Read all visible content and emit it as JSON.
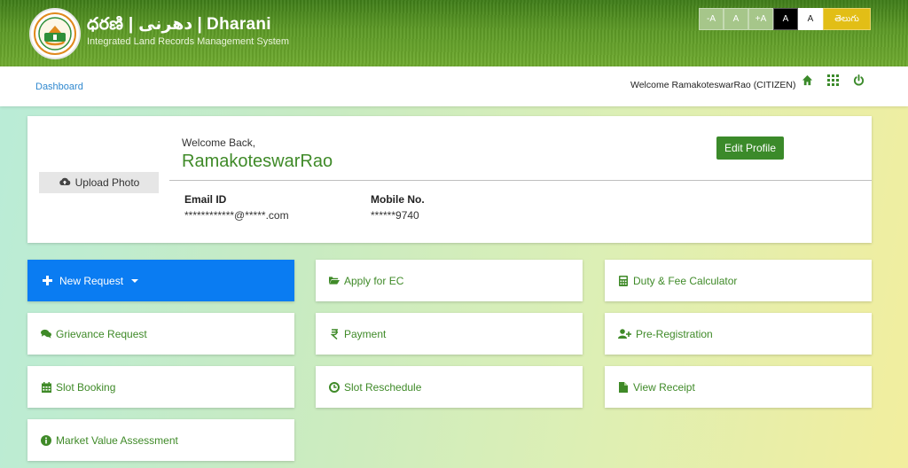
{
  "header": {
    "title": "ధరణి | دھرنی | Dharani",
    "subtitle": "Integrated Land Records Management System",
    "font_controls": [
      "-A",
      "A",
      "+A",
      "A",
      "A"
    ],
    "language_button": "తెలుగు"
  },
  "nav": {
    "breadcrumb": "Dashboard",
    "welcome_text": "Welcome  RamakoteswarRao (CITIZEN)",
    "icons": [
      "home-icon",
      "apps-grid-icon",
      "power-icon"
    ]
  },
  "profile": {
    "upload_label": "Upload Photo",
    "welcome_back": "Welcome Back,",
    "name": "RamakoteswarRao",
    "edit_button": "Edit Profile",
    "email_label": "Email ID",
    "email_value": "************@*****.com",
    "mobile_label": "Mobile No.",
    "mobile_value": "******9740"
  },
  "tiles": [
    {
      "label": "New Request",
      "icon": "plus-icon"
    },
    {
      "label": "Apply for EC",
      "icon": "folder-open-icon"
    },
    {
      "label": "Duty & Fee Calculator",
      "icon": "calculator-icon"
    },
    {
      "label": "Grievance Request",
      "icon": "comments-icon"
    },
    {
      "label": "Payment",
      "icon": "rupee-icon"
    },
    {
      "label": "Pre-Registration",
      "icon": "user-plus-icon"
    },
    {
      "label": "Slot Booking",
      "icon": "calendar-icon"
    },
    {
      "label": "Slot Reschedule",
      "icon": "clock-icon"
    },
    {
      "label": "View Receipt",
      "icon": "file-icon"
    },
    {
      "label": "Market Value Assessment",
      "icon": "info-circle-icon"
    }
  ],
  "colors": {
    "primary_blue": "#0a7cf2",
    "accent_green": "#3f8a28",
    "header_green": "#5d9a26",
    "language_yellow": "#e2be16"
  }
}
